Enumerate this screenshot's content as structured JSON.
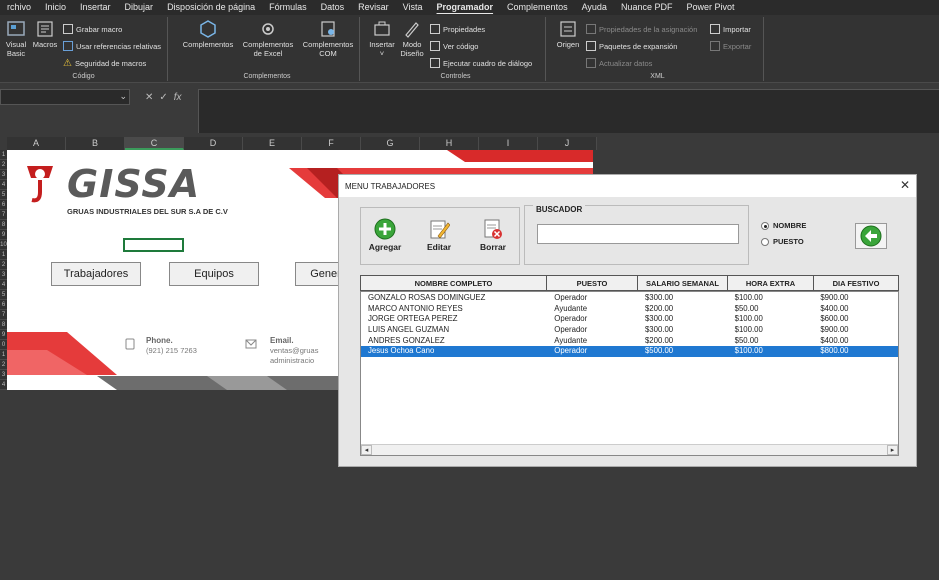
{
  "ribbon_tabs": [
    "rchivo",
    "Inicio",
    "Insertar",
    "Dibujar",
    "Disposición de página",
    "Fórmulas",
    "Datos",
    "Revisar",
    "Vista",
    "Programador",
    "Complementos",
    "Ayuda",
    "Nuance PDF",
    "Power Pivot"
  ],
  "active_tab": "Programador",
  "groups": {
    "codigo": {
      "label": "Código",
      "visual_basic_line1": "Visual",
      "visual_basic_line2": "Basic",
      "macros": "Macros",
      "grabar_macro": "Grabar macro",
      "usar_referencias": "Usar referencias relativas",
      "seguridad": "Seguridad de macros"
    },
    "complementos": {
      "label": "Complementos",
      "complementos": "Complementos",
      "excel_line1": "Complementos",
      "excel_line2": "de Excel",
      "com_line1": "Complementos",
      "com_line2": "COM"
    },
    "controles": {
      "label": "Controles",
      "insertar": "Insertar",
      "modo_line1": "Modo",
      "modo_line2": "Diseño",
      "propiedades": "Propiedades",
      "ver_codigo": "Ver código",
      "ejecutar": "Ejecutar cuadro de diálogo"
    },
    "xml": {
      "label": "XML",
      "origen": "Origen",
      "propiedades_asignacion": "Propiedades de la asignación",
      "paquetes": "Paquetes de expansión",
      "actualizar": "Actualizar datos",
      "importar": "Importar",
      "exportar": "Exportar"
    }
  },
  "columns": [
    "A",
    "B",
    "C",
    "D",
    "E",
    "F",
    "G",
    "H",
    "I",
    "J"
  ],
  "rows": [
    "1",
    "2",
    "3",
    "4",
    "5",
    "6",
    "7",
    "8",
    "9",
    "10",
    "1",
    "2",
    "3",
    "4",
    "5",
    "6",
    "7",
    "8",
    "9",
    "0",
    "1",
    "2",
    "3",
    "4"
  ],
  "sheet": {
    "logo": "GISSA",
    "subtitle": "GRUAS INDUSTRIALES DEL SUR S.A DE C.V",
    "buttons": {
      "trabajadores": "Trabajadores",
      "equipos": "Equipos",
      "general": "Gener"
    },
    "phone_title": "Phone.",
    "phone_value": "(921) 215 7263",
    "email_title": "Email.",
    "email_value1": "ventas@gruas",
    "email_value2": "administracio"
  },
  "dialog": {
    "title": "MENU TRABAJADORES",
    "agregar": "Agregar",
    "editar": "Editar",
    "borrar": "Borrar",
    "buscador": "BUSCADOR",
    "search_value": "",
    "radio_nombre": "NOMBRE",
    "radio_puesto": "PUESTO",
    "headers": [
      "NOMBRE COMPLETO",
      "PUESTO",
      "SALARIO SEMANAL",
      "HORA EXTRA",
      "DIA FESTIVO"
    ],
    "rows": [
      [
        "GONZALO ROSAS DOMINGUEZ",
        "Operador",
        "$300.00",
        "$100.00",
        "$900.00"
      ],
      [
        "MARCO ANTONIO REYES",
        "Ayudante",
        "$200.00",
        "$50.00",
        "$400.00"
      ],
      [
        "JORGE ORTEGA PEREZ",
        "Operador",
        "$300.00",
        "$100.00",
        "$600.00"
      ],
      [
        "LUIS ANGEL GUZMAN",
        "Operador",
        "$300.00",
        "$100.00",
        "$900.00"
      ],
      [
        "ANDRES GONZALEZ",
        "Ayudante",
        "$200.00",
        "$50.00",
        "$400.00"
      ],
      [
        "Jesus Ochoa Cano",
        "Operador",
        "$500.00",
        "$100.00",
        "$800.00"
      ]
    ],
    "selected_row": 5
  }
}
